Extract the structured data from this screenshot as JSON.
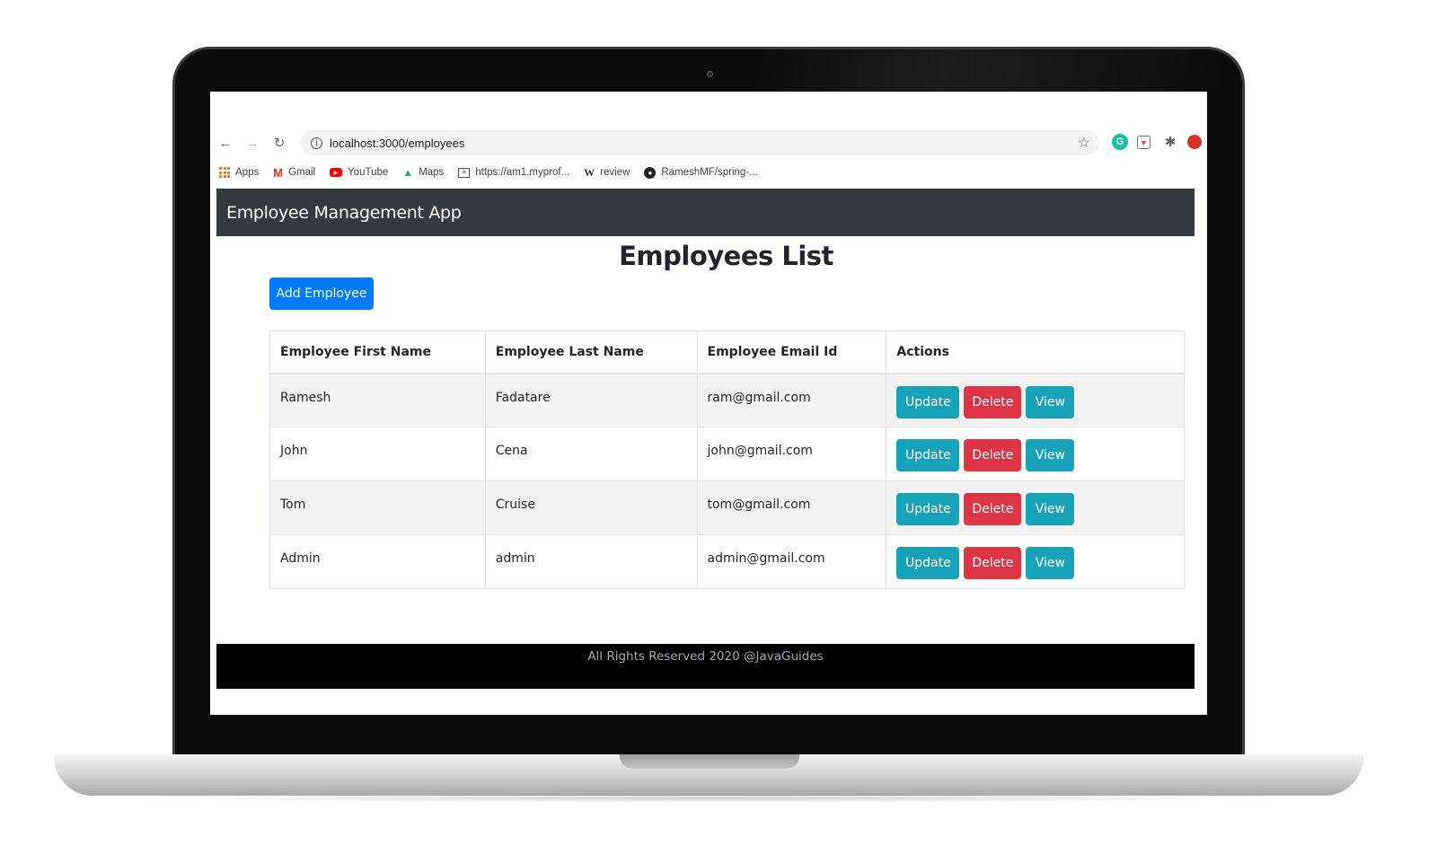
{
  "browser": {
    "url": "localhost:3000/employees",
    "bookmarks": [
      {
        "label": "Apps",
        "icon": "apps-grid-icon"
      },
      {
        "label": "Gmail",
        "icon": "gmail-icon"
      },
      {
        "label": "YouTube",
        "icon": "youtube-icon"
      },
      {
        "label": "Maps",
        "icon": "maps-icon"
      },
      {
        "label": "https://am1.myprof...",
        "icon": "mail-icon"
      },
      {
        "label": "review",
        "icon": "wikipedia-icon"
      },
      {
        "label": "RameshMF/spring-...",
        "icon": "github-icon"
      }
    ]
  },
  "app": {
    "brand": "Employee Management App",
    "page_title": "Employees List",
    "add_button_label": "Add Employee",
    "colors": {
      "header": "#343a40",
      "primary": "#007bff",
      "info": "#17a2b8",
      "danger": "#dc3545",
      "footer": "#000000"
    }
  },
  "table": {
    "headers": [
      "Employee First Name",
      "Employee Last Name",
      "Employee Email Id",
      "Actions"
    ],
    "rows": [
      {
        "first": "Ramesh",
        "last": "Fadatare",
        "email": "ram@gmail.com"
      },
      {
        "first": "John",
        "last": "Cena",
        "email": "john@gmail.com"
      },
      {
        "first": "Tom",
        "last": "Cruise",
        "email": "tom@gmail.com"
      },
      {
        "first": "Admin",
        "last": "admin",
        "email": "admin@gmail.com"
      }
    ],
    "action_labels": {
      "update": "Update",
      "delete": "Delete",
      "view": "View"
    }
  },
  "footer": {
    "text": "All Rights Reserved 2020 @JavaGuides"
  }
}
